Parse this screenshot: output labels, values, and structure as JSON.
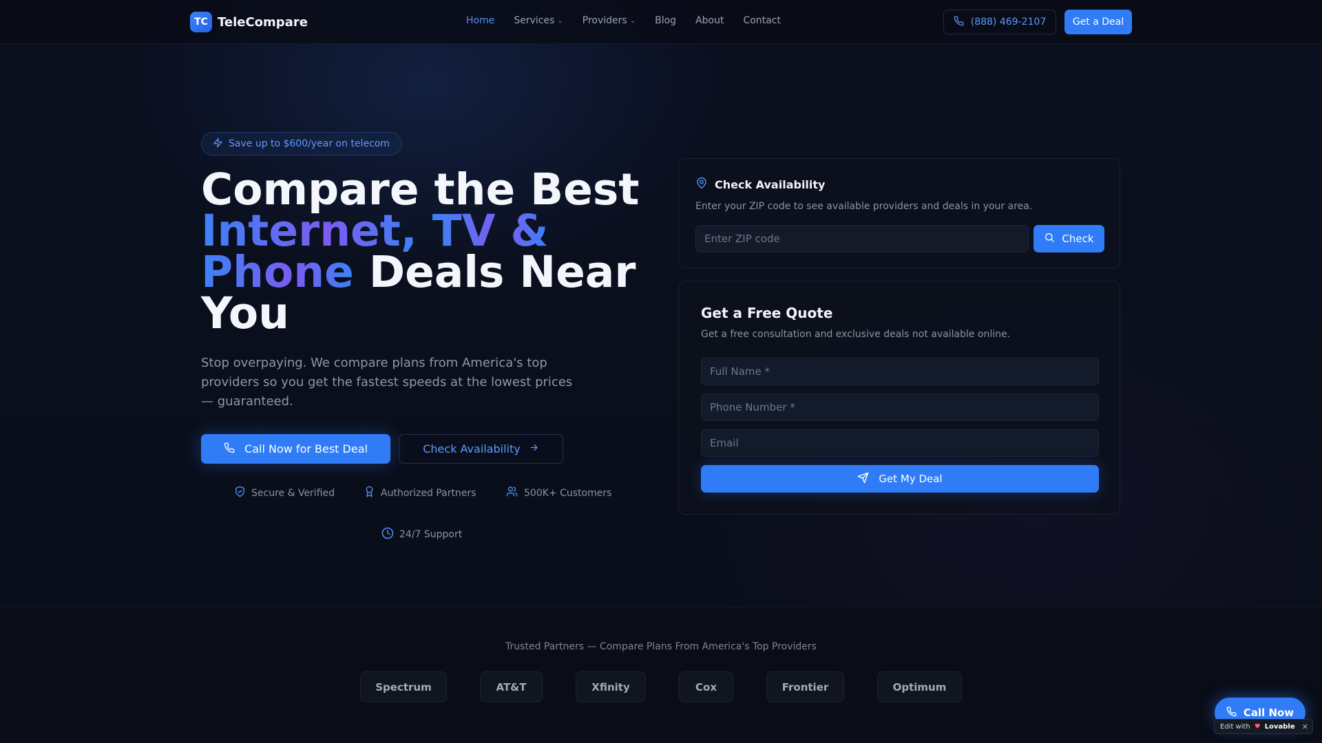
{
  "nav": {
    "logo_badge": "TC",
    "logo_text": "TeleCompare",
    "links": [
      {
        "label": "Home",
        "active": true
      },
      {
        "label": "Services",
        "dropdown": true
      },
      {
        "label": "Providers",
        "dropdown": true
      },
      {
        "label": "Blog"
      },
      {
        "label": "About"
      },
      {
        "label": "Contact"
      }
    ],
    "phone": "(888) 469-2107",
    "cta": "Get a Deal"
  },
  "hero": {
    "pill": "Save up to $600/year on telecom",
    "headline_1": "Compare the Best",
    "headline_accent_1": "Internet,",
    "headline_accent_2": "TV &",
    "headline_accent_3": "Phone",
    "headline_2": "Deals Near",
    "headline_3": "You",
    "subtext": "Stop overpaying. We compare plans from America's top providers so you get the fastest speeds at the lowest prices — guaranteed.",
    "cta_call": "Call Now for Best Deal",
    "cta_check": "Check Availability",
    "badges": {
      "secure": "Secure & Verified",
      "authorized": "Authorized Partners",
      "customers": "500K+ Customers",
      "support": "24/7 Support"
    }
  },
  "availability": {
    "title": "Check Availability",
    "description": "Enter your ZIP code to see available providers and deals in your area.",
    "zip_placeholder": "Enter ZIP code",
    "button": "Check"
  },
  "quote": {
    "title": "Get a Free Quote",
    "description": "Get a free consultation and exclusive deals not available online.",
    "name_placeholder": "Full Name *",
    "phone_placeholder": "Phone Number *",
    "email_placeholder": "Email",
    "submit": "Get My Deal"
  },
  "partners": {
    "heading": "Trusted Partners — Compare Plans From America's Top Providers",
    "list": [
      "Spectrum",
      "AT&T",
      "Xfinity",
      "Cox",
      "Frontier",
      "Optimum"
    ]
  },
  "floating": {
    "call": "Call Now",
    "edit_with": "Edit with",
    "brand": "Lovable"
  },
  "colors": {
    "accent": "#2f7cf6",
    "accent_text": "#5b9bff",
    "gradient_purple": "#7c5cf0",
    "background": "#0a0e1a"
  }
}
